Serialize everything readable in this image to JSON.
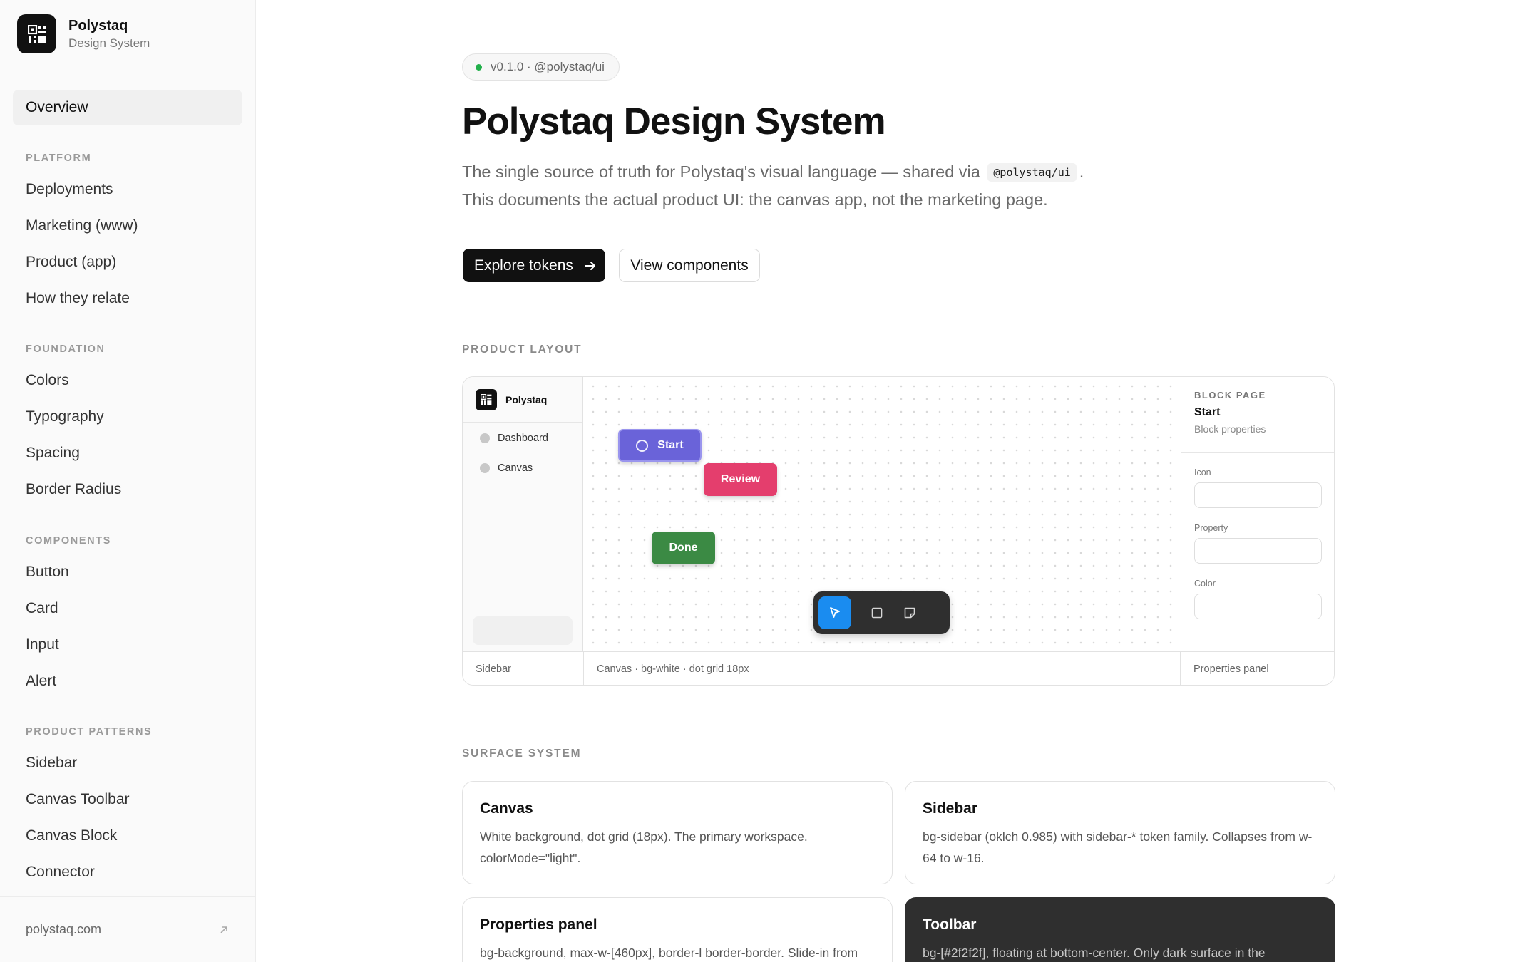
{
  "brand": {
    "name": "Polystaq",
    "subtitle": "Design System"
  },
  "nav": {
    "overview": "Overview",
    "sections": [
      {
        "title": "PLATFORM",
        "items": [
          "Deployments",
          "Marketing (www)",
          "Product (app)",
          "How they relate"
        ]
      },
      {
        "title": "FOUNDATION",
        "items": [
          "Colors",
          "Typography",
          "Spacing",
          "Border Radius"
        ]
      },
      {
        "title": "COMPONENTS",
        "items": [
          "Button",
          "Card",
          "Input",
          "Alert"
        ]
      },
      {
        "title": "PRODUCT PATTERNS",
        "items": [
          "Sidebar",
          "Canvas Toolbar",
          "Canvas Block",
          "Connector"
        ]
      }
    ],
    "footer_link": "polystaq.com"
  },
  "hero": {
    "version": "v0.1.0 · @polystaq/ui",
    "title": "Polystaq Design System",
    "intro_part1": "The single source of truth for Polystaq's visual language — shared via",
    "intro_code": "@polystaq/ui",
    "intro_part2": ".",
    "intro_line2": "This documents the actual product UI: the canvas app, not the marketing page.",
    "primary_button": "Explore tokens",
    "secondary_button": "View components"
  },
  "product_layout": {
    "label": "PRODUCT LAYOUT",
    "sidebar": {
      "brand": "Polystaq",
      "items": [
        "Dashboard",
        "Canvas"
      ]
    },
    "blocks": {
      "start": "Start",
      "review": "Review",
      "done": "Done"
    },
    "props": {
      "kicker": "BLOCK PAGE",
      "title": "Start",
      "subtitle": "Block properties",
      "fields": [
        "Icon",
        "Property",
        "Color"
      ]
    },
    "footer": {
      "sidebar": "Sidebar",
      "canvas": "Canvas · bg-white · dot grid 18px",
      "props": "Properties panel"
    },
    "colors": {
      "start": "#6a63d9",
      "review": "#e43e6d",
      "done": "#3b8a44",
      "tool_active": "#1a8cf0",
      "toolbar": "#2f2f2f"
    }
  },
  "surface_system": {
    "label": "SURFACE SYSTEM",
    "cards": [
      {
        "title": "Canvas",
        "text": "White background, dot grid (18px). The primary workspace. colorMode=\"light\"."
      },
      {
        "title": "Sidebar",
        "text": "bg-sidebar (oklch 0.985) with sidebar-* token family. Collapses from w-64 to w-16."
      },
      {
        "title": "Properties panel",
        "text": "bg-background, max-w-[460px], border-l border-border. Slide-in from"
      },
      {
        "title": "Toolbar",
        "text": "bg-[#2f2f2f], floating at bottom-center. Only dark surface in the"
      }
    ]
  }
}
